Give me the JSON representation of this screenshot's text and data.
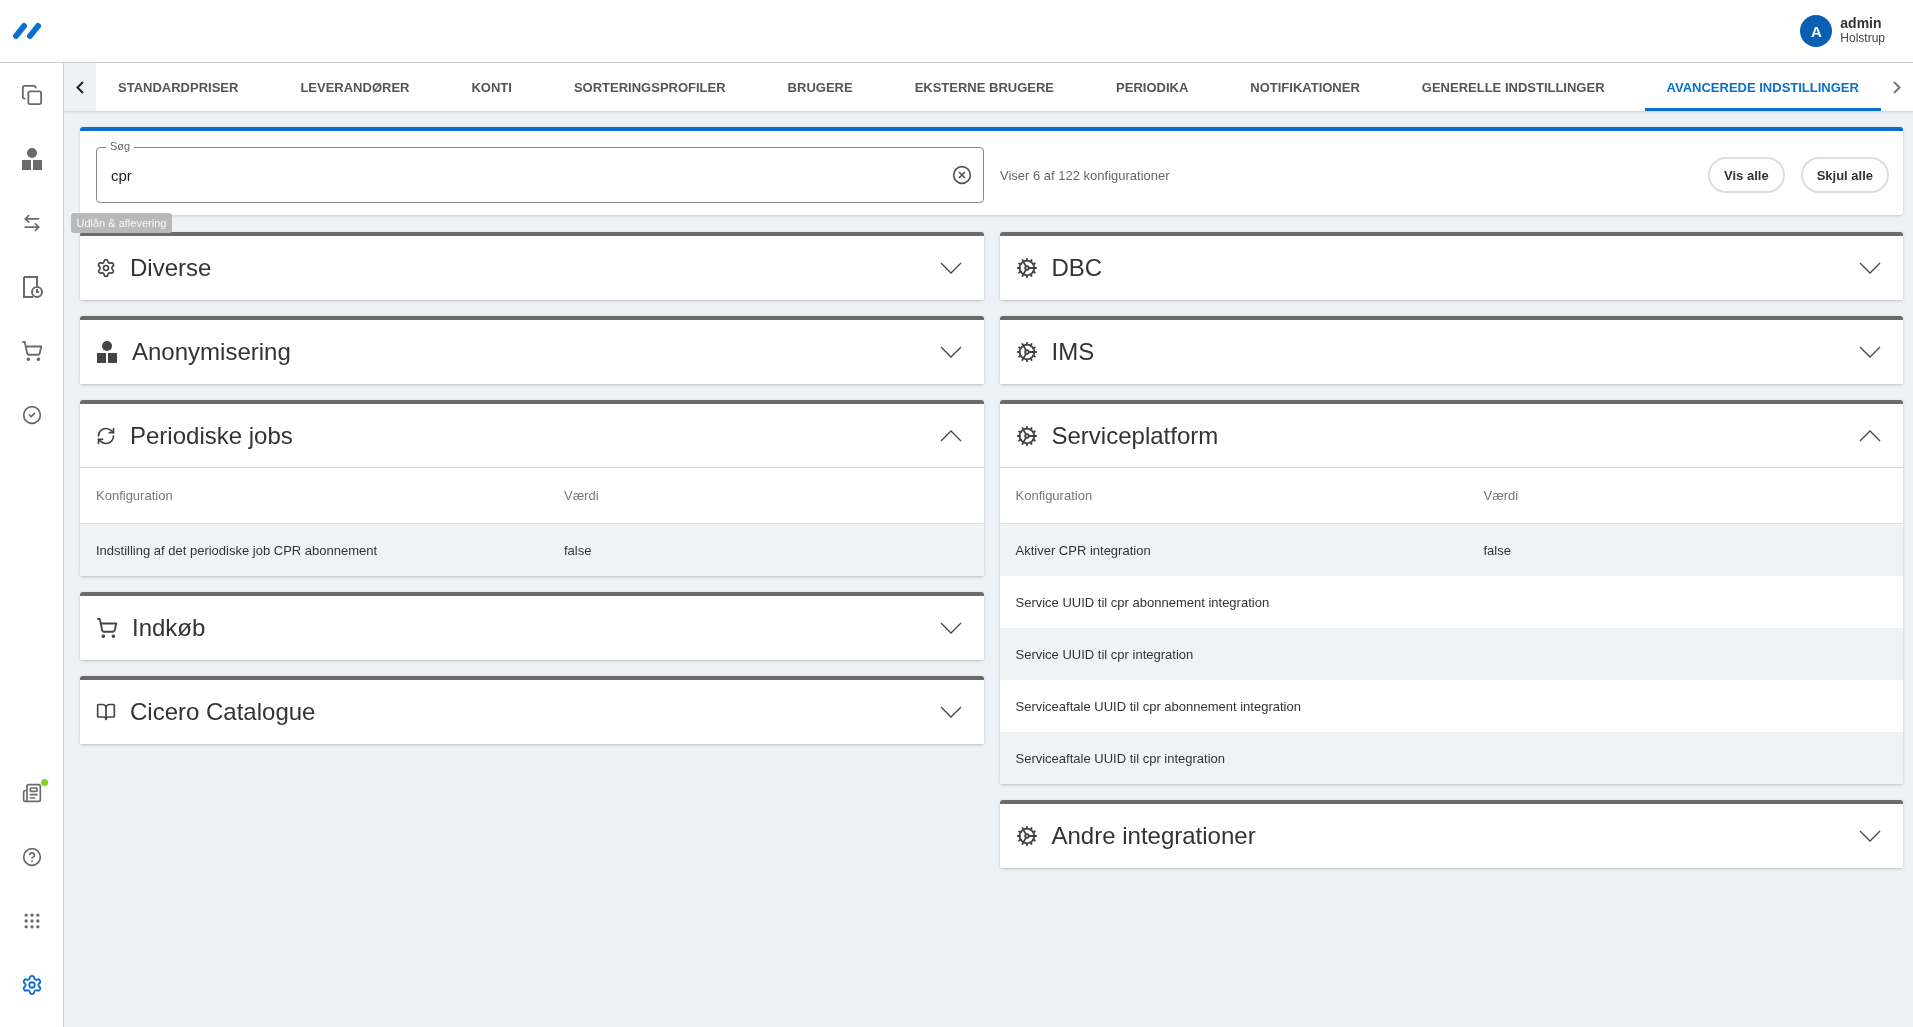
{
  "header": {
    "user": {
      "initial": "A",
      "name": "admin",
      "location": "Holstrup"
    }
  },
  "sidebar": {
    "items": [
      {
        "selected": false,
        "notification": false
      },
      {
        "selected": false,
        "notification": false
      },
      {
        "selected": false,
        "notification": false,
        "tooltip": "Udlån & aflevering"
      },
      {
        "selected": false,
        "notification": false
      },
      {
        "selected": false,
        "notification": false
      },
      {
        "selected": false,
        "notification": false
      }
    ],
    "bottom_items": [
      {
        "selected": false,
        "notification": true
      },
      {
        "selected": false,
        "notification": false
      },
      {
        "selected": false,
        "notification": false
      },
      {
        "selected": true,
        "notification": false
      }
    ]
  },
  "tabs": [
    {
      "label": "STANDARDPRISER",
      "selected": false
    },
    {
      "label": "LEVERANDØRER",
      "selected": false
    },
    {
      "label": "KONTI",
      "selected": false
    },
    {
      "label": "SORTERINGSPROFILER",
      "selected": false
    },
    {
      "label": "BRUGERE",
      "selected": false
    },
    {
      "label": "EKSTERNE BRUGERE",
      "selected": false
    },
    {
      "label": "PERIODIKA",
      "selected": false
    },
    {
      "label": "NOTIFIKATIONER",
      "selected": false
    },
    {
      "label": "GENERELLE INDSTILLINGER",
      "selected": false
    },
    {
      "label": "AVANCEREDE INDSTILLINGER",
      "selected": true
    }
  ],
  "search": {
    "label": "Søg",
    "value": "cpr",
    "result_text": "Viser 6 af 122 konfigurationer",
    "buttons": [
      "Vis alle",
      "Skjul alle"
    ]
  },
  "left_panels": [
    {
      "title": "Diverse",
      "expanded": false
    },
    {
      "title": "Anonymisering",
      "expanded": false
    },
    {
      "title": "Periodiske jobs",
      "expanded": true,
      "columns": [
        "Konfiguration",
        "Værdi"
      ],
      "rows": [
        {
          "configuration": "Indstilling af det periodiske job CPR abonnement",
          "value": "false"
        }
      ]
    },
    {
      "title": "Indkøb",
      "expanded": false
    },
    {
      "title": "Cicero Catalogue",
      "expanded": false
    }
  ],
  "right_panels": [
    {
      "title": "DBC",
      "expanded": false
    },
    {
      "title": "IMS",
      "expanded": false
    },
    {
      "title": "Serviceplatform",
      "expanded": true,
      "columns": [
        "Konfiguration",
        "Værdi"
      ],
      "rows": [
        {
          "configuration": "Aktiver CPR integration",
          "value": "false"
        },
        {
          "configuration": "Service UUID til cpr abonnement integration"
        },
        {
          "configuration": "Service UUID til cpr integration"
        },
        {
          "configuration": "Serviceaftale UUID til cpr abonnement integration"
        },
        {
          "configuration": "Serviceaftale UUID til cpr integration"
        }
      ]
    },
    {
      "title": "Andre integrationer",
      "expanded": false
    }
  ]
}
